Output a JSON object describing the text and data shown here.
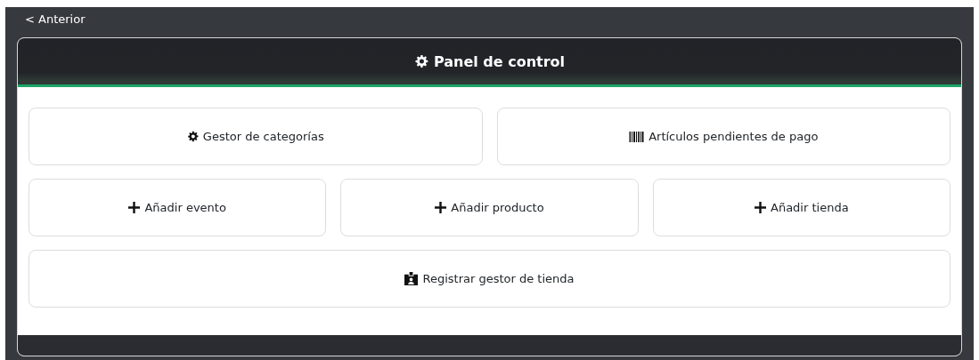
{
  "back_link": {
    "label": "< Anterior"
  },
  "panel": {
    "title": "Panel de control"
  },
  "button_rows": [
    {
      "buttons": [
        {
          "label": "Gestor de categorías",
          "kind": "settings"
        },
        {
          "label": "Artículos pendientes de pago",
          "kind": "pending"
        }
      ]
    },
    {
      "buttons": [
        {
          "label": "Añadir evento",
          "kind": "add"
        },
        {
          "label": "Añadir producto",
          "kind": "add"
        },
        {
          "label": "Añadir tienda",
          "kind": "add"
        }
      ]
    },
    {
      "buttons": [
        {
          "label": "Registrar gestor de tienda",
          "kind": "register"
        }
      ]
    }
  ]
}
